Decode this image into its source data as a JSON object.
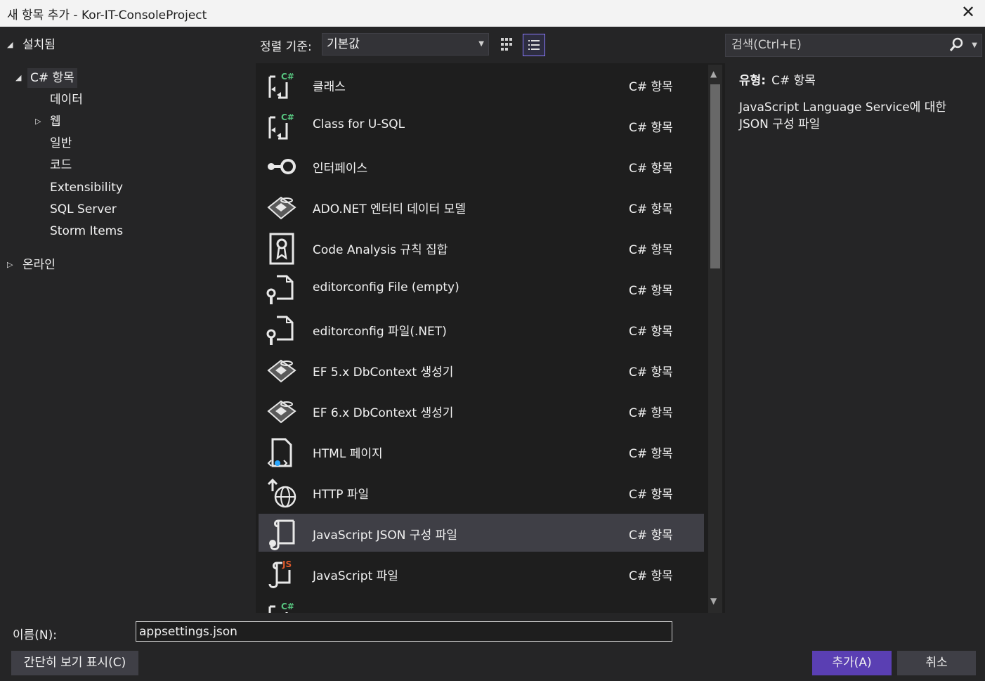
{
  "window": {
    "title": "새 항목 추가 - Kor-IT-ConsoleProject",
    "close_glyph": "✕"
  },
  "tree": {
    "installed": "설치됨",
    "csharp_items": "C# 항목",
    "children": [
      "데이터",
      "웹",
      "일반",
      "코드",
      "Extensibility",
      "SQL Server",
      "Storm Items"
    ],
    "online": "온라인"
  },
  "toolbar": {
    "sort_label": "정렬 기준:",
    "sort_value": "기본값"
  },
  "items": [
    {
      "name": "클래스",
      "category": "C# 항목",
      "icon": "class-cs-icon"
    },
    {
      "name": "Class for U-SQL",
      "category": "C# 항목",
      "icon": "class-cs-icon"
    },
    {
      "name": "인터페이스",
      "category": "C# 항목",
      "icon": "interface-icon"
    },
    {
      "name": "ADO.NET 엔터티 데이터 모델",
      "category": "C# 항목",
      "icon": "entity-model-icon"
    },
    {
      "name": "Code Analysis 규칙 집합",
      "category": "C# 항목",
      "icon": "ruleset-icon"
    },
    {
      "name": "editorconfig File (empty)",
      "category": "C# 항목",
      "icon": "editorconfig-icon"
    },
    {
      "name": "editorconfig 파일(.NET)",
      "category": "C# 항목",
      "icon": "editorconfig-icon"
    },
    {
      "name": "EF 5.x DbContext 생성기",
      "category": "C# 항목",
      "icon": "entity-model-icon"
    },
    {
      "name": "EF 6.x DbContext 생성기",
      "category": "C# 항목",
      "icon": "entity-model-icon"
    },
    {
      "name": "HTML 페이지",
      "category": "C# 항목",
      "icon": "html-page-icon"
    },
    {
      "name": "HTTP 파일",
      "category": "C# 항목",
      "icon": "http-globe-icon"
    },
    {
      "name": "JavaScript JSON 구성 파일",
      "category": "C# 항목",
      "icon": "json-config-icon"
    },
    {
      "name": "JavaScript 파일",
      "category": "C# 항목",
      "icon": "javascript-file-icon"
    }
  ],
  "detail": {
    "type_label": "유형:",
    "type_value": "C# 항목",
    "description": "JavaScript Language Service에 대한 JSON 구성 파일"
  },
  "search": {
    "placeholder": "검색(Ctrl+E)"
  },
  "footer": {
    "name_label": "이름(N):",
    "name_value": "appsettings.json",
    "compact_view": "간단히 보기 표시(C)",
    "add": "추가(A)",
    "cancel": "취소"
  },
  "colors": {
    "accent": "#5a3fb3",
    "selection": "#3f3f46",
    "csharp_badge": "#57c47f",
    "js_badge": "#e05a2b"
  }
}
